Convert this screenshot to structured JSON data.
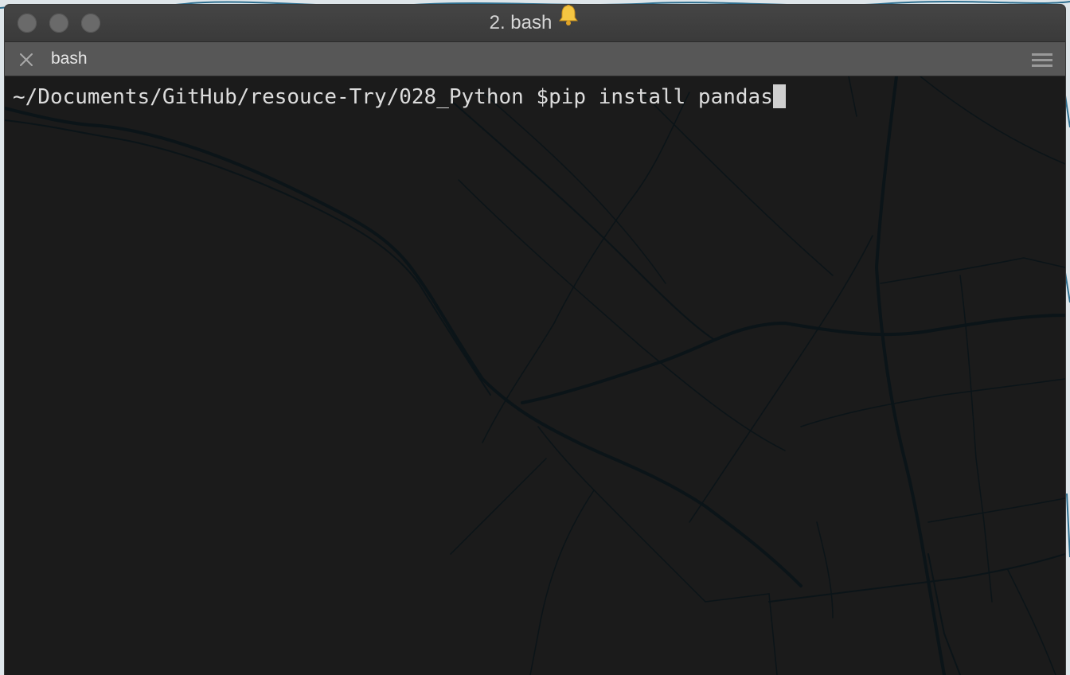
{
  "window": {
    "title": "2. bash",
    "title_icon": "bell-icon"
  },
  "tab": {
    "label": "bash",
    "close_icon": "close-icon",
    "menu_icon": "hamburger-menu-icon"
  },
  "terminal": {
    "prompt": "~/Documents/GitHub/resouce-Try/028_Python $",
    "command": "pip install pandas"
  },
  "colors": {
    "terminal_bg": "#1b1b1b",
    "text": "#dcdcdc",
    "titlebar": "#3e3e3e",
    "tabbar": "#575757",
    "map_lines": "#0b1418"
  }
}
